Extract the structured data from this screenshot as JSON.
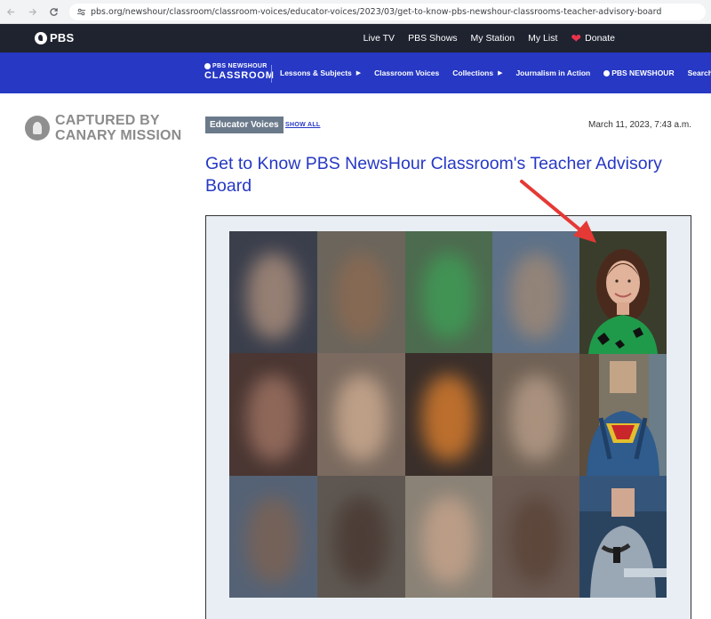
{
  "browser": {
    "url": "pbs.org/newshour/classroom/classroom-voices/educator-voices/2023/03/get-to-know-pbs-newshour-classrooms-teacher-advisory-board"
  },
  "pbs_bar": {
    "logo_text": "PBS",
    "links": [
      "Live TV",
      "PBS Shows",
      "My Station",
      "My List"
    ],
    "donate_label": "Donate"
  },
  "newshour_bar": {
    "logo_small": "PBS NEWSHOUR",
    "logo_big": "CLASSROOM",
    "links": [
      {
        "label": "Lessons & Subjects",
        "has_arrow": true
      },
      {
        "label": "Classroom Voices",
        "has_arrow": false
      },
      {
        "label": "Collections",
        "has_arrow": true
      },
      {
        "label": "Journalism in Action",
        "has_arrow": false
      },
      {
        "label": "PBS NEWSHOUR",
        "has_arrow": false
      },
      {
        "label": "Search",
        "has_arrow": false
      }
    ]
  },
  "watermark": {
    "line1": "CAPTURED BY",
    "line2": "CANARY MISSION"
  },
  "article": {
    "category": "Educator Voices",
    "show_all": "SHOW ALL",
    "date": "March 11, 2023, 7:43 a.m.",
    "title": "Get to Know PBS NewsHour Classroom's Teacher Advisory Board"
  },
  "colors": {
    "pbs_dark": "#1f2330",
    "newshour_blue": "#2638c4",
    "title_blue": "#2638c4",
    "badge_gray": "#6b7a8a",
    "arrow_red": "#e53935",
    "heart_red": "#e8334a"
  },
  "icons": [
    "back-icon",
    "forward-icon",
    "reload-icon",
    "site-info-icon",
    "pbs-logo-icon",
    "heart-icon",
    "canary-seal-icon",
    "red-arrow-icon"
  ]
}
